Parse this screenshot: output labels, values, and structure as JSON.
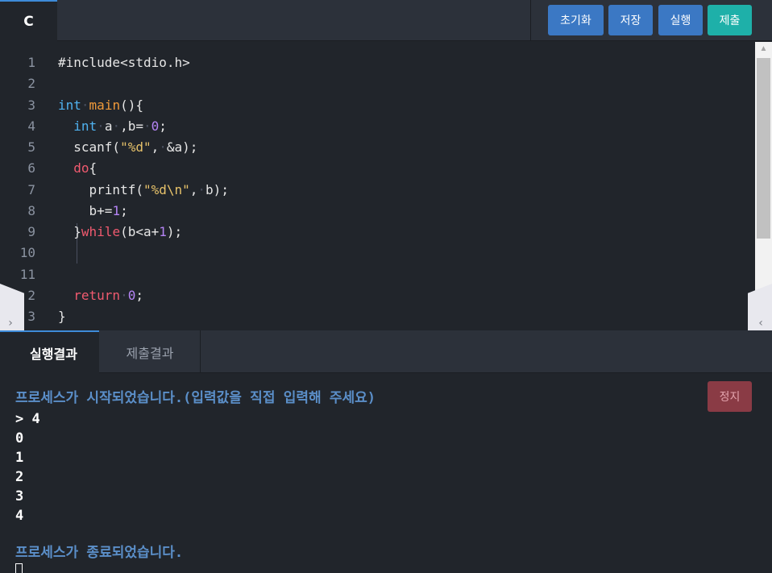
{
  "toolbar": {
    "language": "C",
    "reset_label": "초기화",
    "save_label": "저장",
    "run_label": "실행",
    "submit_label": "제출"
  },
  "editor": {
    "line_numbers": [
      "1",
      "2",
      "3",
      "4",
      "5",
      "6",
      "7",
      "8",
      "9",
      "10",
      "11",
      "2",
      "3"
    ],
    "code_lines": [
      "#include<stdio.h>",
      "",
      "int main(){",
      "  int a ,b= 0;",
      "  scanf(\"%d\", &a);",
      "  do{",
      "    printf(\"%d\\n\", b);",
      "    b+=1;",
      "  }while(b<a+1);",
      "",
      "",
      "  return 0;",
      "}"
    ]
  },
  "side_handles": {
    "left_glyph": "›",
    "right_glyph": "‹"
  },
  "result_tabs": {
    "run_result": "실행결과",
    "submit_result": "제출결과"
  },
  "console": {
    "stop_label": "정지",
    "start_message": "프로세스가 시작되었습니다.(입력값을 직접 입력해 주세요)",
    "input_line": "> 4",
    "outputs": [
      "0",
      "1",
      "2",
      "3",
      "4"
    ],
    "end_message": "프로세스가 종료되었습니다."
  },
  "colors": {
    "background": "#21252b",
    "panel": "#2c313a",
    "button_blue": "#3b78c4",
    "button_teal": "#1eb0a9",
    "stop_button": "#8a3b45",
    "keyword": "#4fb2f0",
    "function": "#f09a3a",
    "number": "#b584f5",
    "string": "#e7c26a",
    "control": "#f05a6f",
    "console_message": "#5b8fc9"
  }
}
